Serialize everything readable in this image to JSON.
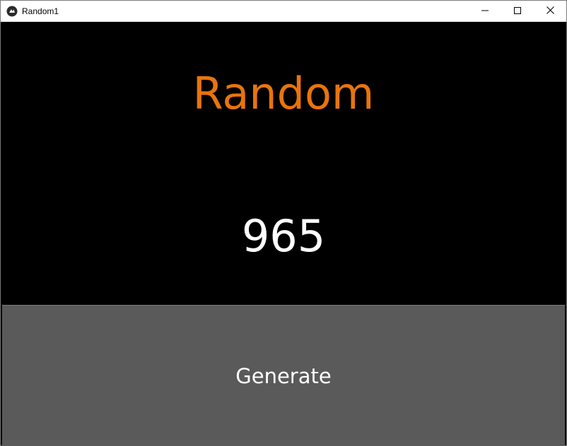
{
  "window": {
    "title": "Random1",
    "icon": "kivy-app-icon",
    "controls": {
      "minimize": "minimize-icon",
      "maximize": "maximize-icon",
      "close": "close-icon"
    }
  },
  "main": {
    "heading": "Random",
    "value": "965",
    "button_label": "Generate"
  },
  "colors": {
    "heading": "#e8740c",
    "background": "#000000",
    "button": "#5a5a5a",
    "value": "#ffffff"
  }
}
